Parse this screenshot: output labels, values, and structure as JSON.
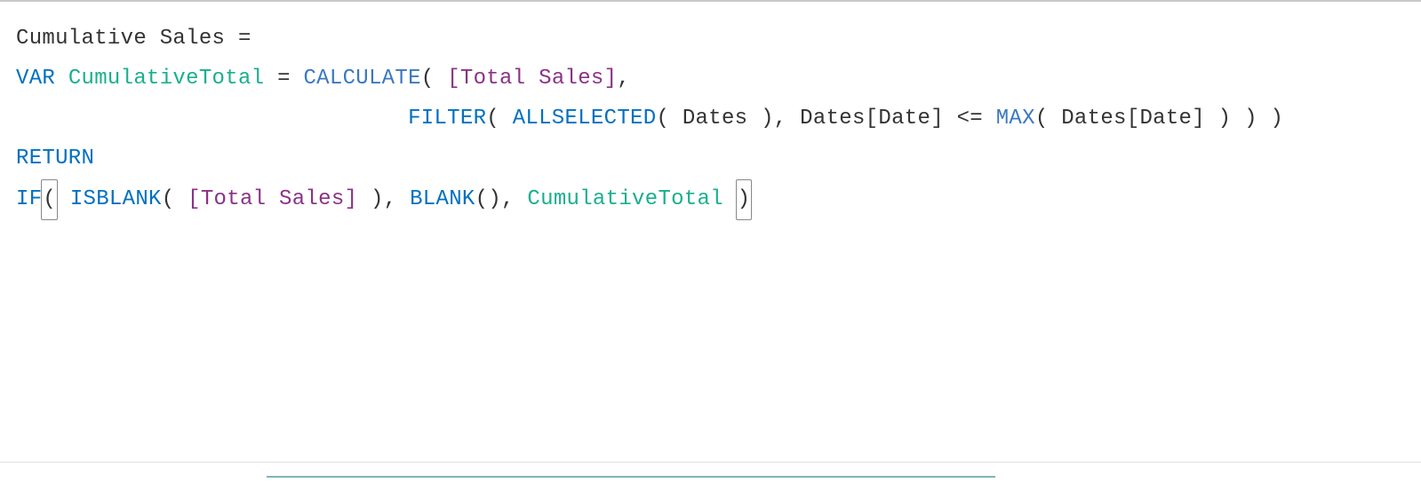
{
  "formula": {
    "measure_name": "Cumulative Sales",
    "eq1": " =",
    "var_kw": "VAR",
    "sp1": " ",
    "var_name": "CumulativeTotal",
    "sp2": " ",
    "eq2": "=",
    "sp3": " ",
    "calculate_fn": "CALCULATE",
    "open1": "(",
    "sp4": " ",
    "total_sales_ref": "[Total Sales]",
    "comma1": ",",
    "indent": "                              ",
    "filter_fn": "FILTER",
    "open2": "(",
    "sp5": " ",
    "allselected_fn": "ALLSELECTED",
    "open3": "(",
    "sp6": " ",
    "dates_tbl": "Dates",
    "sp7": " ",
    "close3": ")",
    "comma2": ",",
    "sp8": " ",
    "dates_col1": "Dates[Date]",
    "sp9": " ",
    "cmp": "<=",
    "sp10": " ",
    "max_fn": "MAX",
    "open4": "(",
    "sp11": " ",
    "dates_col2": "Dates[Date]",
    "sp12": " ",
    "close4": ")",
    "sp13": " ",
    "close2": ")",
    "sp14": " ",
    "close1": ")",
    "return_kw": "RETURN",
    "if_fn": "IF",
    "bracket_open": "(",
    "sp15": " ",
    "isblank_fn": "ISBLANK",
    "open5": "(",
    "sp16": " ",
    "total_sales_ref2": "[Total Sales]",
    "sp17": " ",
    "close5": ")",
    "comma3": ",",
    "sp18": " ",
    "blank_fn": "BLANK",
    "open6": "(",
    "close6": ")",
    "comma4": ",",
    "sp19": " ",
    "var_ref": "CumulativeTotal",
    "sp20": " ",
    "bracket_close": ")"
  }
}
